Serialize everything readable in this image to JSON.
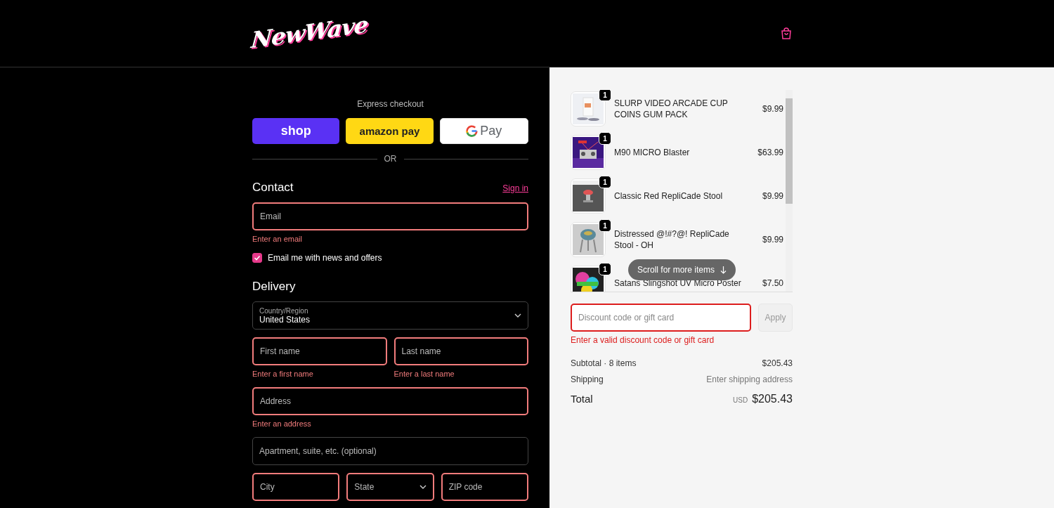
{
  "header": {
    "logo": "NewWave"
  },
  "express": {
    "title": "Express checkout",
    "buttons": [
      {
        "kind": "shop",
        "label": "shop"
      },
      {
        "kind": "amazon",
        "label": "amazon pay"
      },
      {
        "kind": "gpay",
        "label": "Pay"
      }
    ],
    "separator": "OR"
  },
  "contact": {
    "heading": "Contact",
    "sign_in": "Sign in",
    "email": {
      "placeholder": "Email",
      "error": "Enter an email",
      "invalid": true
    },
    "newsletter": {
      "label": "Email me with news and offers",
      "checked": true
    }
  },
  "delivery": {
    "heading": "Delivery",
    "rows": [
      [
        {
          "kind": "select",
          "label": "Country/Region",
          "value": "United States",
          "invalid": false
        }
      ],
      [
        {
          "kind": "input",
          "placeholder": "First name",
          "error": "Enter a first name",
          "invalid": true
        },
        {
          "kind": "input",
          "placeholder": "Last name",
          "error": "Enter a last name",
          "invalid": true
        }
      ],
      [
        {
          "kind": "input",
          "placeholder": "Address",
          "error": "Enter an address",
          "invalid": true
        }
      ],
      [
        {
          "kind": "input",
          "placeholder": "Apartment, suite, etc. (optional)",
          "invalid": false
        }
      ],
      [
        {
          "kind": "input",
          "placeholder": "City",
          "invalid": true
        },
        {
          "kind": "select",
          "placeholder": "State",
          "invalid": true
        },
        {
          "kind": "input",
          "placeholder": "ZIP code",
          "invalid": true
        }
      ]
    ]
  },
  "summary": {
    "items": [
      {
        "name": "SLURP VIDEO ARCADE CUP COINS GUM PACK",
        "price": "$9.99",
        "quantity": "1"
      },
      {
        "name": "M90 MICRO Blaster",
        "price": "$63.99",
        "quantity": "1"
      },
      {
        "name": "Classic Red RepliCade Stool",
        "price": "$9.99",
        "quantity": "1"
      },
      {
        "name": "Distressed @!#?@! RepliCade Stool - OH",
        "price": "$9.99",
        "quantity": "1"
      },
      {
        "name": "Satans Slingshot UV Micro Poster",
        "price": "$7.50",
        "quantity": "1"
      }
    ],
    "scroll_hint": "Scroll for more items",
    "discount": {
      "placeholder": "Discount code or gift card",
      "error": "Enter a valid discount code or gift card",
      "invalid": true
    },
    "apply": {
      "label": "Apply",
      "disabled": true
    },
    "subtotal": {
      "label": "Subtotal · 8 items",
      "value": "$205.43"
    },
    "shipping": {
      "label": "Shipping",
      "value": "Enter shipping address"
    },
    "total": {
      "label": "Total",
      "currency": "USD",
      "value": "$205.43"
    }
  }
}
